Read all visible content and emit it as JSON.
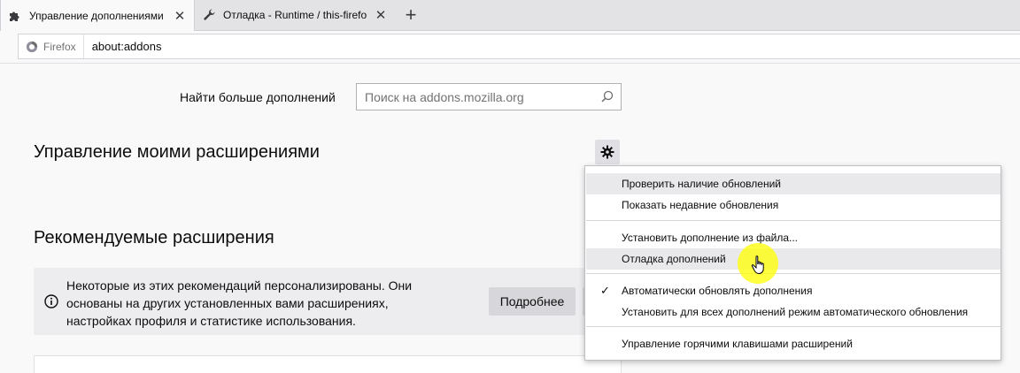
{
  "tabs": [
    {
      "title": "Управление дополнениями",
      "icon": "puzzle-icon",
      "active": true
    },
    {
      "title": "Отладка - Runtime / this-firefo",
      "icon": "wrench-icon",
      "active": false
    }
  ],
  "urlbar": {
    "identity_label": "Firefox",
    "url": "about:addons"
  },
  "search": {
    "label": "Найти больше дополнений",
    "placeholder": "Поиск на addons.mozilla.org"
  },
  "manage": {
    "heading": "Управление моими расширениями"
  },
  "recommended": {
    "heading": "Рекомендуемые расширения",
    "notice_lines": [
      "Некоторые из этих рекомендаций персонализированы. Они",
      "основаны на других установленных вами расширениях,",
      "настройках профиля и статистике использования."
    ],
    "more_button": "Подробнее"
  },
  "menu": {
    "items": [
      {
        "label": "Проверить наличие обновлений",
        "highlighted": true
      },
      {
        "label": "Показать недавние обновления",
        "highlighted": false
      },
      {
        "label": "Установить дополнение из файла...",
        "highlighted": false
      },
      {
        "label": "Отладка дополнений",
        "highlighted": true
      },
      {
        "label": "Автоматически обновлять дополнения",
        "checked": true
      },
      {
        "label": "Установить для всех дополнений режим автоматического обновления",
        "highlighted": false
      },
      {
        "label": "Управление горячими клавишами расширений",
        "highlighted": false
      }
    ]
  },
  "colors": {
    "tabstrip_bg": "#e3e3e6",
    "page_bg": "#f9f9fa",
    "menu_hover": "#e9e9ec",
    "cursor_halo": "#ffff00"
  }
}
